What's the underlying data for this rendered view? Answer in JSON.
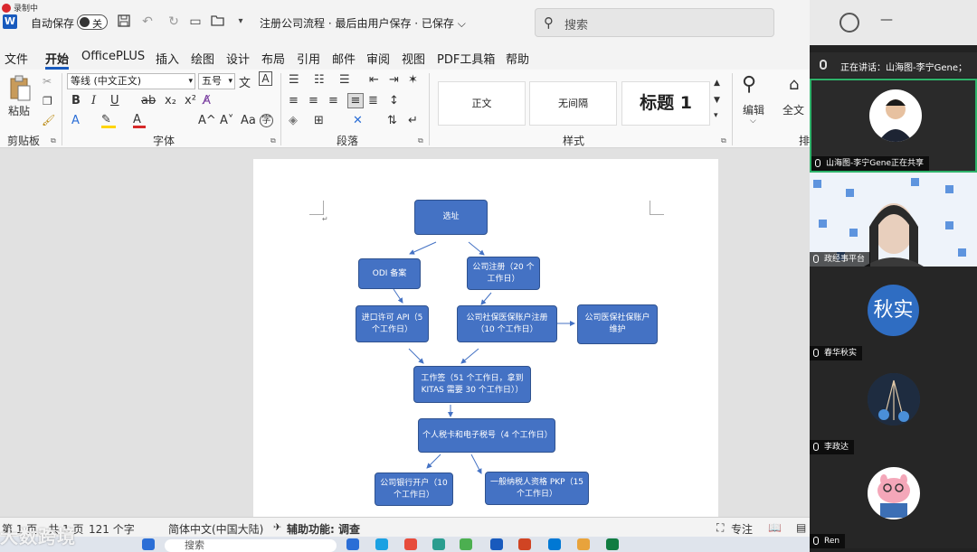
{
  "titlebar": {
    "recording_badge": "录制中",
    "app_icon": "W",
    "autosave_label": "自动保存",
    "autosave_state": "关",
    "doc_title": "注册公司流程 · 最后由用户保存 · 已保存",
    "title_chevron": "⌵",
    "search_placeholder": "搜索",
    "icons": [
      "save-icon",
      "undo-icon",
      "redo-icon",
      "open-folder-icon",
      "customize-icon",
      "search-icon",
      "user-icon",
      "minimize-icon",
      "restore-icon"
    ]
  },
  "menu": {
    "items": [
      "文件",
      "开始",
      "OfficePLUS",
      "插入",
      "绘图",
      "设计",
      "布局",
      "引用",
      "邮件",
      "审阅",
      "视图",
      "PDF工具箱",
      "帮助"
    ],
    "active": "开始"
  },
  "ribbon": {
    "clipboard": {
      "paste_label": "粘贴",
      "group_label": "剪贴板"
    },
    "font": {
      "font_name": "等线 (中文正文)",
      "font_size": "五号",
      "group_label": "字体",
      "b": "B",
      "i": "I",
      "u": "U",
      "strike": "ab",
      "sub": "x₂",
      "sup": "x²",
      "grow": "A^",
      "shrink": "A˅",
      "aa": "Aa",
      "wen": "文",
      "ch": "A"
    },
    "paragraph": {
      "group_label": "段落"
    },
    "styles": {
      "items": [
        "正文",
        "无间隔",
        "标题 1"
      ],
      "group_label": "样式"
    },
    "editing": {
      "label": "编辑"
    },
    "fulltext": {
      "label": "全文"
    },
    "more": {
      "label": "排"
    }
  },
  "document": {
    "flow": {
      "site": "选址",
      "odi": "ODI 备案",
      "register": "公司注册（20 个工作日）",
      "import": "进口许可 API（5 个工作日）",
      "social": "公司社保医保账户注册（10 个工作日）",
      "maintain": "公司医保社保账户维护",
      "visa": "工作签（51 个工作日，拿到 KITAS 需要 30 个工作日））",
      "tax": "个人税卡和电子税号（4 个工作日）",
      "bank": "公司银行开户（10 个工作日）",
      "pkp": "一般纳税人资格 PKP（15 个工作日）"
    }
  },
  "statusbar": {
    "page_info": "第 1 页，共 1 页",
    "word_count": "121 个字",
    "language": "简体中文(中国大陆)",
    "accessibility": "辅助功能: 调查",
    "focus": "专注"
  },
  "taskbar": {
    "search_placeholder": "搜索",
    "watermark": "大数跨境",
    "icon_colors": [
      "#2b6ed6",
      "#1ba1e2",
      "#e74c3c",
      "#2a9d8f",
      "#4caf50",
      "#185abd",
      "#d04423",
      "#0078d4",
      "#e8a33c",
      "#107c41"
    ]
  },
  "meeting": {
    "speaking_label": "正在讲话：山海图-李宁Gene；",
    "participants": [
      {
        "name": "山海图-李宁Gene正在共享",
        "kind": "photo"
      },
      {
        "name": "政经事平台",
        "kind": "video"
      },
      {
        "name": "春华秋实",
        "initial": "秋实",
        "kind": "initial"
      },
      {
        "name": "李政达",
        "kind": "photo"
      },
      {
        "name": "Ren",
        "kind": "cartoon"
      }
    ]
  }
}
